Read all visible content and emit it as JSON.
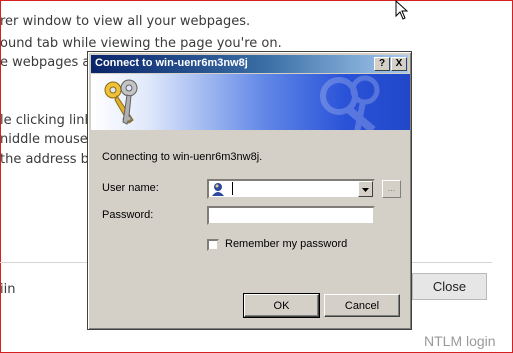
{
  "background": {
    "lines": [
      "rer window to view all your webpages.",
      "ound tab while viewing the page you're on.",
      "e webpages at",
      "le clicking links",
      "niddle mouse",
      " the address b"
    ],
    "bottom_left_text": "iin",
    "close_label": "Close"
  },
  "dialog": {
    "title": "Connect to win-uenr6m3nw8j",
    "help_button": "?",
    "close_button": "X",
    "message": "Connecting to win-uenr6m3nw8j.",
    "username_label": "User name:",
    "username_value": "",
    "password_label": "Password:",
    "password_value": "",
    "remember_label": "Remember my password",
    "remember_checked": false,
    "browse_label": "...",
    "ok_label": "OK",
    "cancel_label": "Cancel"
  },
  "caption": "NTLM login",
  "colors": {
    "frame_border": "#d42020",
    "title_gradient_start": "#0a246a",
    "dialog_face": "#d4d0c8"
  }
}
